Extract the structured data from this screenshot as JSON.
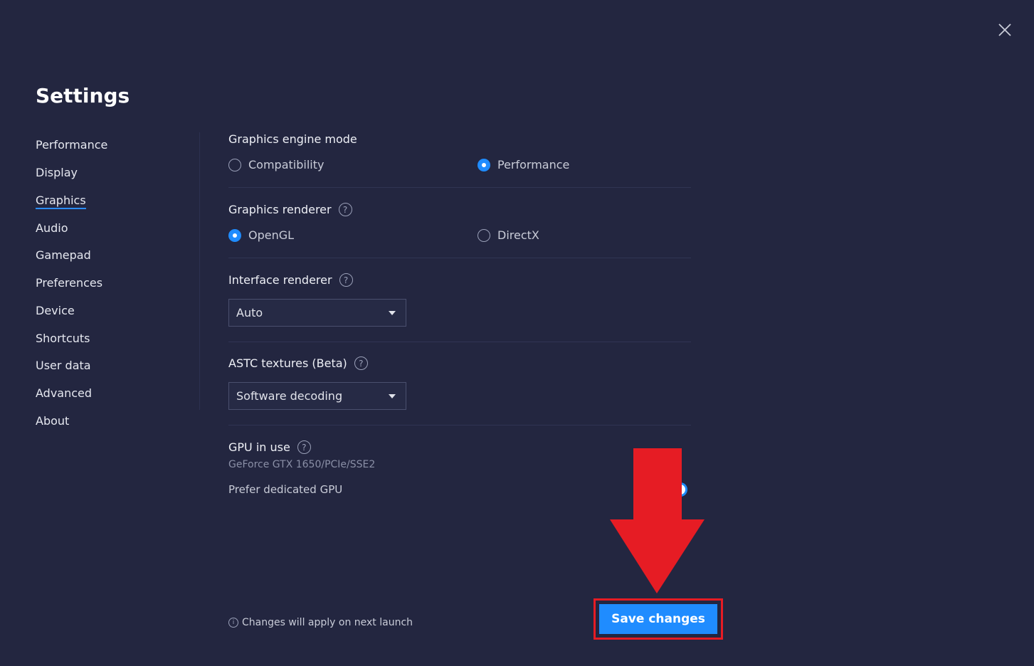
{
  "title": "Settings",
  "sidebar": {
    "items": [
      {
        "label": "Performance"
      },
      {
        "label": "Display"
      },
      {
        "label": "Graphics",
        "active": true
      },
      {
        "label": "Audio"
      },
      {
        "label": "Gamepad"
      },
      {
        "label": "Preferences"
      },
      {
        "label": "Device"
      },
      {
        "label": "Shortcuts"
      },
      {
        "label": "User data"
      },
      {
        "label": "Advanced"
      },
      {
        "label": "About"
      }
    ]
  },
  "engine": {
    "label": "Graphics engine mode",
    "options": [
      "Compatibility",
      "Performance"
    ],
    "selected": "Performance"
  },
  "renderer": {
    "label": "Graphics renderer",
    "options": [
      "OpenGL",
      "DirectX"
    ],
    "selected": "OpenGL"
  },
  "interface": {
    "label": "Interface renderer",
    "value": "Auto"
  },
  "astc": {
    "label": "ASTC textures (Beta)",
    "value": "Software decoding"
  },
  "gpu": {
    "label": "GPU in use",
    "value": "GeForce GTX 1650/PCIe/SSE2",
    "prefer_label": "Prefer dedicated GPU",
    "prefer_on": true
  },
  "footer": {
    "note": "Changes will apply on next launch",
    "save_label": "Save changes"
  },
  "help_glyph": "?",
  "info_glyph": "i",
  "colors": {
    "accent": "#1f8cff",
    "annotation": "#e61c24",
    "background": "#232640"
  }
}
